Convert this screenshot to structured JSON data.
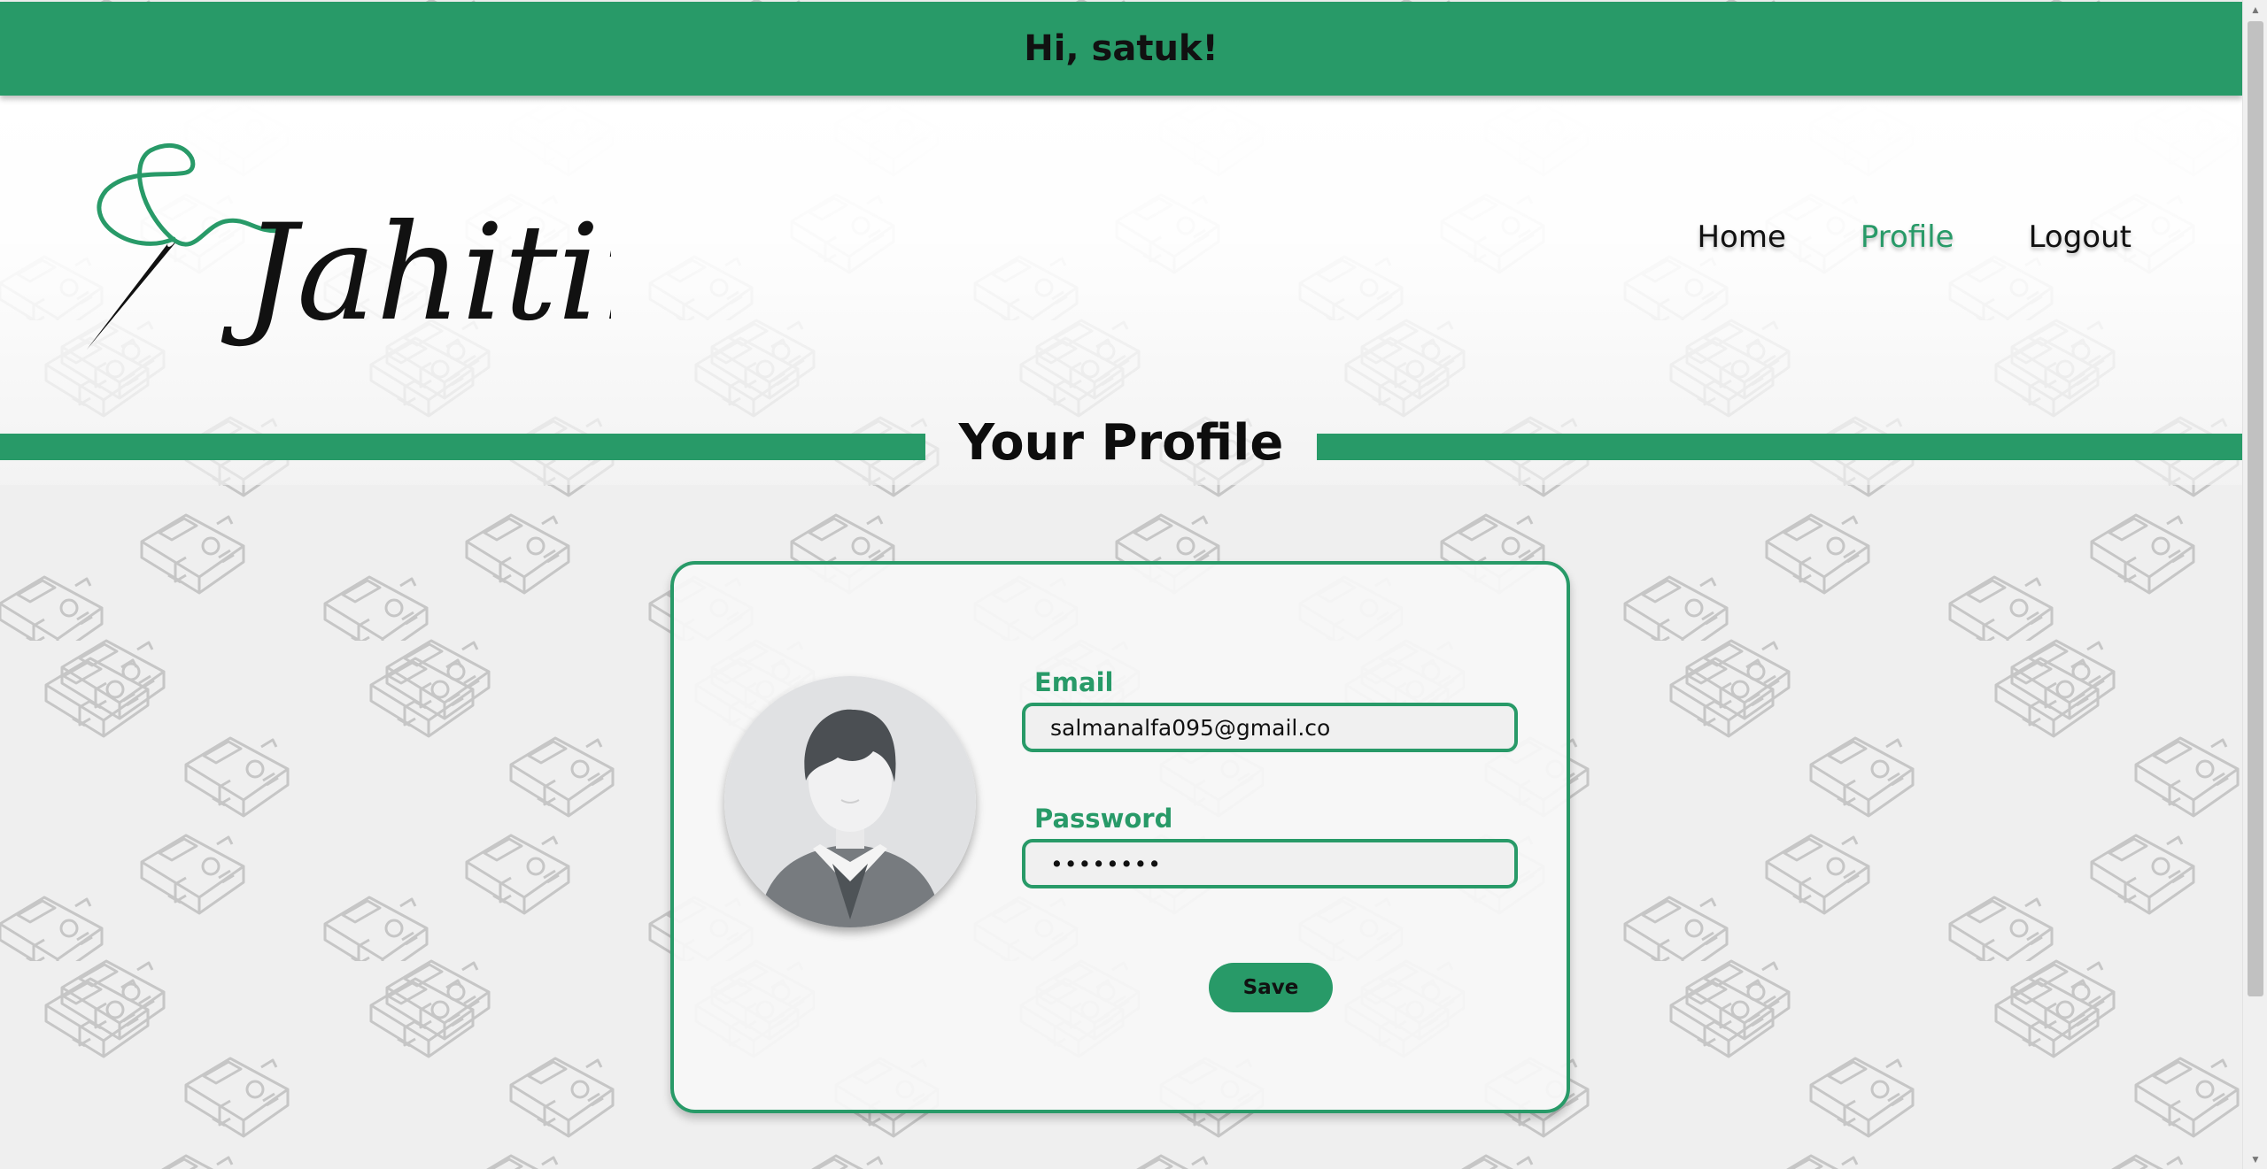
{
  "banner": {
    "greeting": "Hi, satuk!"
  },
  "logo": {
    "text": "Jahitin"
  },
  "nav": {
    "items": [
      {
        "label": "Home",
        "active": false
      },
      {
        "label": "Profile",
        "active": true
      },
      {
        "label": "Logout",
        "active": false
      }
    ]
  },
  "page": {
    "title": "Your Profile"
  },
  "profile": {
    "email_label": "Email",
    "email_value": "salmanalfa095@gmail.co",
    "password_label": "Password",
    "password_value": "••••••••",
    "save_label": "Save"
  },
  "colors": {
    "accent": "#289a68",
    "text": "#111111",
    "background": "#efefef"
  }
}
